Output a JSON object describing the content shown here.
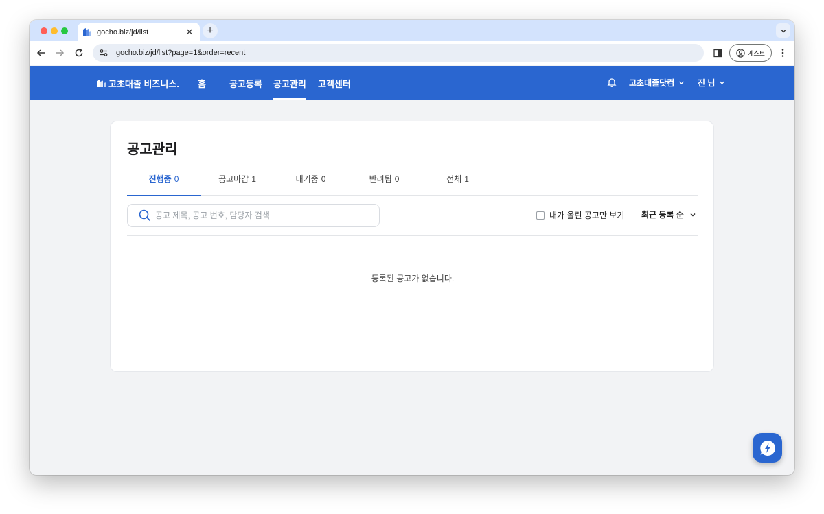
{
  "browser": {
    "tab_title": "gocho.biz/jd/list",
    "tab_close": "✕",
    "new_tab": "+",
    "url": "gocho.biz/jd/list?page=1&order=recent",
    "profile_label": "게스트"
  },
  "header": {
    "logo": "고초대졸 비즈니스.",
    "nav": [
      {
        "label": "홈"
      },
      {
        "label": "공고등록"
      },
      {
        "label": "공고관리"
      },
      {
        "label": "고객센터"
      }
    ],
    "company_dropdown": "고초대졸닷컴",
    "user_dropdown": "진 님",
    "accent_color": "#2a66d0"
  },
  "main": {
    "title": "공고관리",
    "tabs": [
      {
        "label": "진행중",
        "count": "0"
      },
      {
        "label": "공고마감",
        "count": "1"
      },
      {
        "label": "대기중",
        "count": "0"
      },
      {
        "label": "반려됨",
        "count": "0"
      },
      {
        "label": "전체",
        "count": "1"
      }
    ],
    "search_placeholder": "공고 제목, 공고 번호, 담당자 검색",
    "mine_only_label": "내가 올린 공고만 보기",
    "sort_label": "최근 등록 순",
    "empty_message": "등록된 공고가 없습니다."
  }
}
